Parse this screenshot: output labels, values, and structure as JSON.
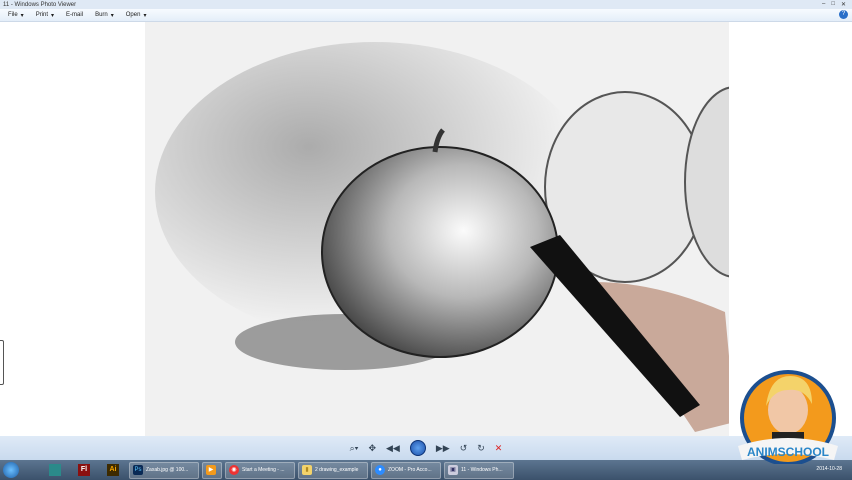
{
  "window": {
    "title": "11 - Windows Photo Viewer"
  },
  "menu": [
    {
      "label": "File"
    },
    {
      "label": "Print"
    },
    {
      "label": "E-mail"
    },
    {
      "label": "Burn"
    },
    {
      "label": "Open"
    }
  ],
  "help": "?",
  "controls": {
    "zoom": "⌕▾",
    "fit": "✥",
    "prev": "◀◀",
    "play": "▭",
    "next": "▶▶",
    "rotate_ccw": "↺",
    "rotate_cw": "↻",
    "delete": "✕"
  },
  "taskbar": {
    "pinned": [
      "Autodesk",
      "Fl",
      "Ai"
    ],
    "tasks": [
      {
        "icon": "Ps",
        "label": "Zaxab.jpg @ 100..."
      },
      {
        "icon": "▶",
        "label": ""
      },
      {
        "icon": "◉",
        "label": "Start a Meeting - ..."
      },
      {
        "icon": "▮",
        "label": "2 drawing_example"
      },
      {
        "icon": "●",
        "label": "ZOOM - Pro Acco..."
      },
      {
        "icon": "▣",
        "label": "11 - Windows Ph..."
      }
    ],
    "clock": "2014-10-28"
  },
  "logo": {
    "text": "ANIMSCHOOL"
  }
}
